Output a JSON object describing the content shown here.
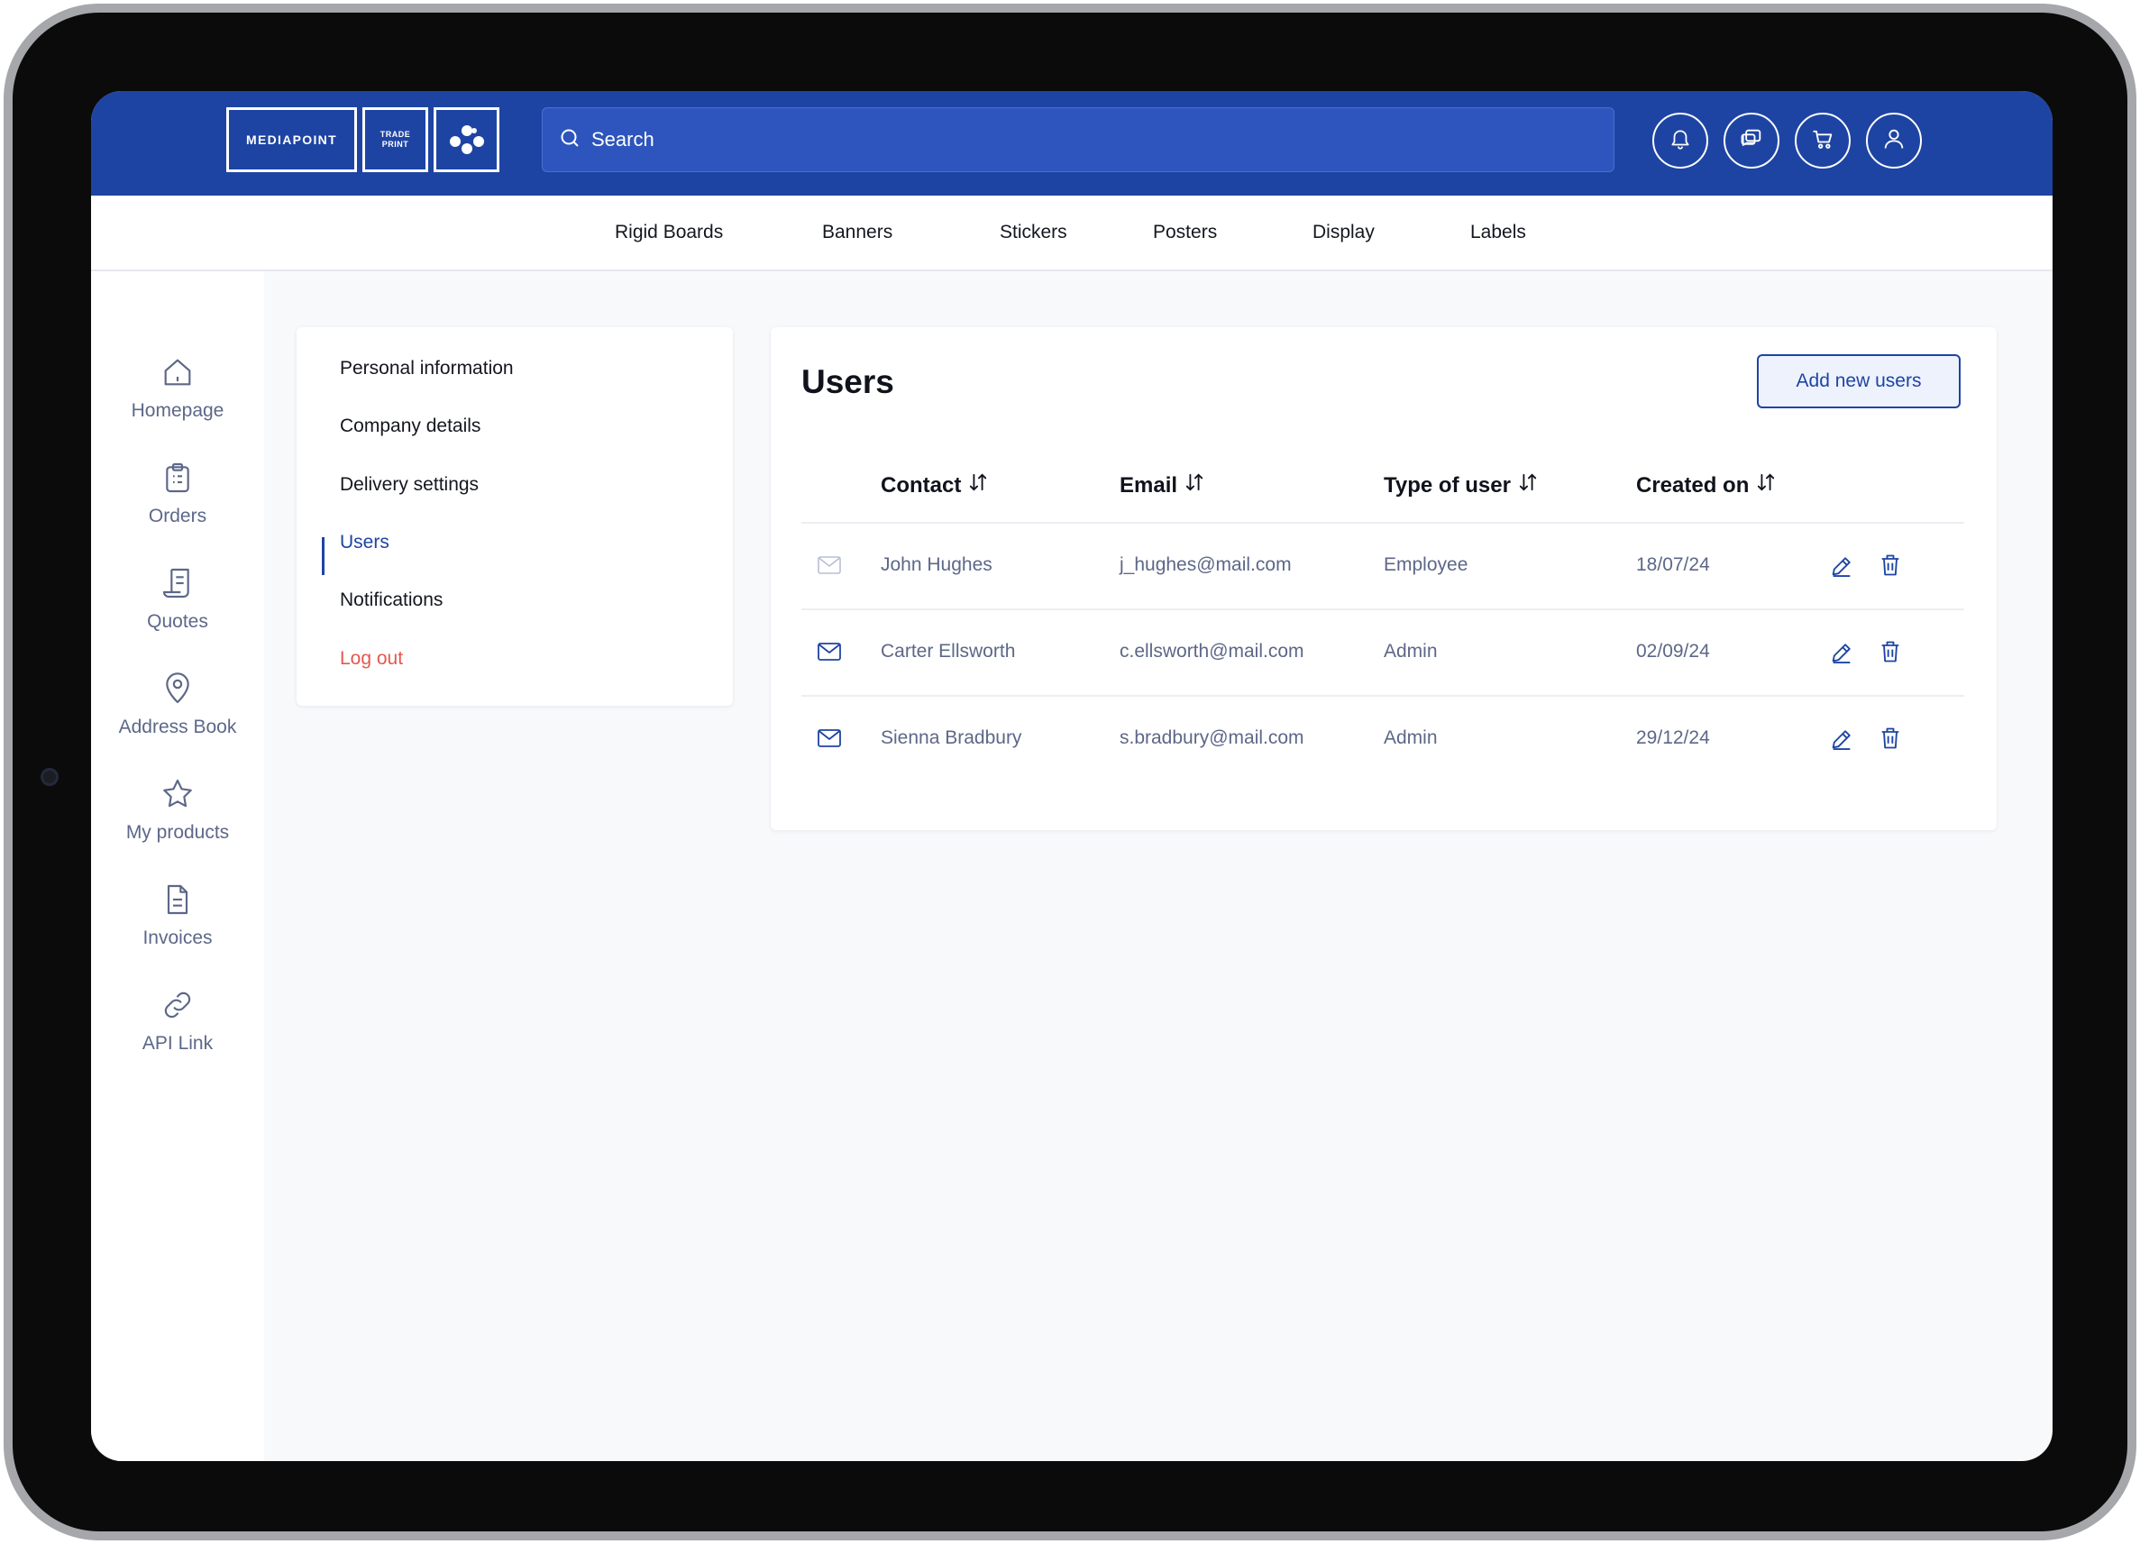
{
  "header": {
    "logo": {
      "brand": "MEDIAPOINT",
      "trade_line1": "TRADE",
      "trade_line2": "PRINT"
    },
    "search": {
      "placeholder": "Search"
    },
    "icons": [
      "bell-icon",
      "chat-icon",
      "cart-icon",
      "user-icon"
    ]
  },
  "categories": [
    "Rigid Boards",
    "Banners",
    "Stickers",
    "Posters",
    "Display",
    "Labels"
  ],
  "rail": {
    "items": [
      {
        "label": "Homepage",
        "icon": "home-icon"
      },
      {
        "label": "Orders",
        "icon": "clipboard-icon"
      },
      {
        "label": "Quotes",
        "icon": "scroll-icon"
      },
      {
        "label": "Address Book",
        "icon": "location-pin-icon"
      },
      {
        "label": "My products",
        "icon": "star-icon"
      },
      {
        "label": "Invoices",
        "icon": "document-icon"
      },
      {
        "label": "API Link",
        "icon": "link-icon"
      }
    ]
  },
  "settings_menu": {
    "items": [
      "Personal information",
      "Company details",
      "Delivery settings",
      "Users",
      "Notifications"
    ],
    "active": "Users",
    "logout": "Log out"
  },
  "users": {
    "title": "Users",
    "add_button": "Add new users",
    "columns": [
      "Contact",
      "Email",
      "Type of user",
      "Created on"
    ],
    "rows": [
      {
        "contact": "John Hughes",
        "email": "j_hughes@mail.com",
        "type": "Employee",
        "created": "18/07/24",
        "mail_state": "read"
      },
      {
        "contact": "Carter Ellsworth",
        "email": "c.ellsworth@mail.com",
        "type": "Admin",
        "created": "02/09/24",
        "mail_state": "unread"
      },
      {
        "contact": "Sienna Bradbury",
        "email": "s.bradbury@mail.com",
        "type": "Admin",
        "created": "29/12/24",
        "mail_state": "unread"
      }
    ]
  },
  "colors": {
    "brand_blue": "#1e44a3",
    "logout_red": "#e4574e",
    "muted_text": "#5d6788"
  }
}
